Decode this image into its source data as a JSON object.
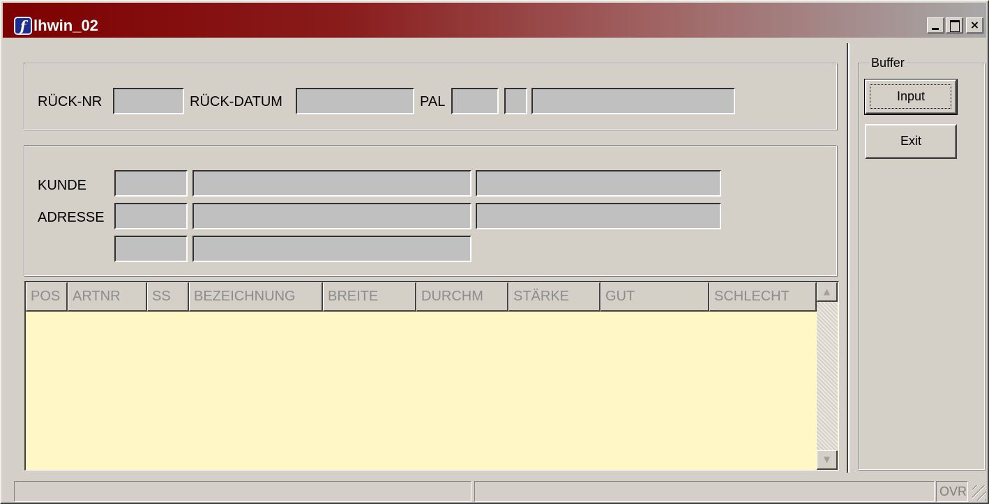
{
  "window": {
    "title": "lhwin_02",
    "icon": "fileMaker-f-icon",
    "controls": {
      "minimize": "minimize-icon",
      "maximize": "maximize-icon",
      "close": "×"
    }
  },
  "header": {
    "rueck_nr_label": "RÜCK-NR",
    "rueck_datum_label": "RÜCK-DATUM",
    "pal_label": "PAL"
  },
  "customer": {
    "kunde_label": "KUNDE",
    "adresse_label": "ADRESSE"
  },
  "table": {
    "columns": [
      "POS",
      "ARTNR",
      "SS",
      "BEZEICHNUNG",
      "BREITE",
      "DURCHM",
      "STÄRKE",
      "GUT",
      "SCHLECHT"
    ],
    "rows": [],
    "background": "#fff7c6"
  },
  "buffer": {
    "legend": "Buffer",
    "input_label": "Input",
    "exit_label": "Exit"
  },
  "statusbar": {
    "mode": "OVR"
  },
  "colors": {
    "title_start": "#7d0000",
    "title_end": "#a8a8a8",
    "face": "#d4d0c8",
    "field": "#c0c0c0"
  }
}
